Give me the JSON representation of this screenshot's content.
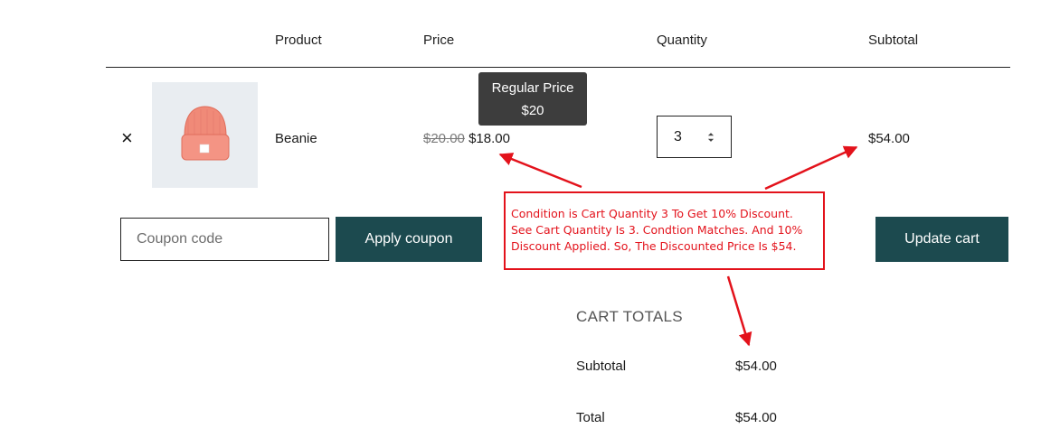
{
  "cart_table": {
    "headers": {
      "product": "Product",
      "price": "Price",
      "quantity": "Quantity",
      "subtotal": "Subtotal"
    },
    "item": {
      "remove_symbol": "×",
      "name": "Beanie",
      "regular_price": "$20.00",
      "sale_price": "$18.00",
      "quantity": "3",
      "subtotal": "$54.00",
      "thumbnail_colors": {
        "background": "#e9edf1",
        "beanie": "#f08a78"
      }
    }
  },
  "tooltip": {
    "line1": "Regular Price",
    "line2": "$20"
  },
  "actions": {
    "coupon_placeholder": "Coupon code",
    "apply_label": "Apply coupon",
    "update_label": "Update cart"
  },
  "annotation": {
    "text": "Condition is Cart Quantity 3 To Get 10% Discount.\nSee Cart Quantity Is 3. Condtion Matches.  And 10%\nDiscount Applied. So, The Discounted Price Is $54.",
    "color": "#e3121b"
  },
  "cart_totals": {
    "heading": "CART TOTALS",
    "rows": [
      {
        "label": "Subtotal",
        "value": "$54.00"
      },
      {
        "label": "Total",
        "value": "$54.00"
      }
    ]
  },
  "colors": {
    "button_bg": "#1c4a4f",
    "tooltip_bg": "#3d3d3d"
  }
}
